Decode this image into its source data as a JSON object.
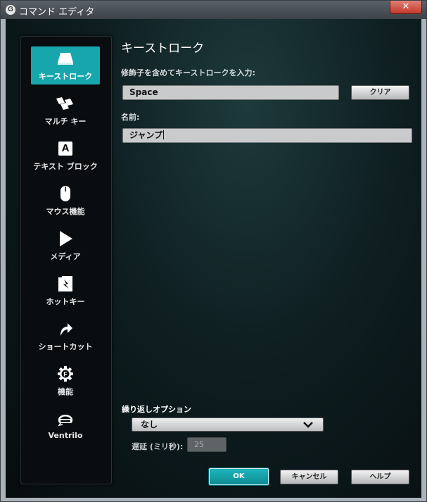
{
  "window": {
    "title": "コマンド エディタ",
    "close_glyph": "✕",
    "app_icon_glyph": "G"
  },
  "sidebar": {
    "items": [
      {
        "label": "キーストローク",
        "icon": "key-icon",
        "selected": true
      },
      {
        "label": "マルチ キー",
        "icon": "multi-key-icon",
        "selected": false
      },
      {
        "label": "テキスト ブロック",
        "icon": "text-block-icon",
        "glyph": "A",
        "selected": false
      },
      {
        "label": "マウス機能",
        "icon": "mouse-icon",
        "selected": false
      },
      {
        "label": "メディア",
        "icon": "play-icon",
        "selected": false
      },
      {
        "label": "ホットキー",
        "icon": "hotkey-icon",
        "selected": false
      },
      {
        "label": "ショートカット",
        "icon": "shortcut-arrow-icon",
        "selected": false
      },
      {
        "label": "機能",
        "icon": "function-gear-icon",
        "glyph": "F",
        "selected": false
      },
      {
        "label": "Ventrilo",
        "icon": "headset-icon",
        "selected": false
      }
    ]
  },
  "main": {
    "title": "キーストローク",
    "keystroke_label": "修飾子を含めてキーストロークを入力:",
    "keystroke_value": "Space",
    "clear_label": "クリア",
    "name_label": "名前:",
    "name_value": "ジャンプ",
    "repeat_label": "繰り返しオプション",
    "repeat_value": "なし",
    "delay_label": "遅延 (ミリ秒):",
    "delay_value": "25"
  },
  "footer": {
    "ok_label": "OK",
    "cancel_label": "キャンセル",
    "help_label": "ヘルプ"
  },
  "colors": {
    "accent": "#18a6ad",
    "background": "#0e1e21",
    "sidebar": "#0a0d0f"
  }
}
